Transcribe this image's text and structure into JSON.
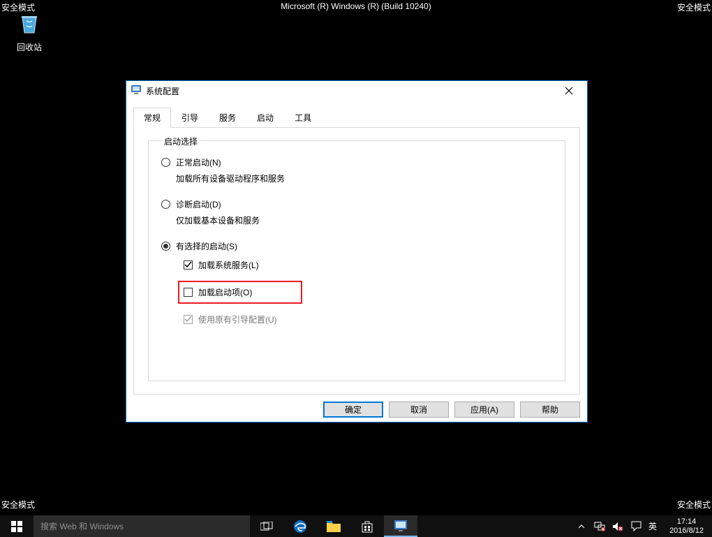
{
  "safe_mode_label": "安全模式",
  "build_info": "Microsoft (R) Windows (R) (Build 10240)",
  "desktop": {
    "recycle_bin": "回收站"
  },
  "dialog": {
    "title": "系统配置",
    "tabs": {
      "general": "常规",
      "boot": "引导",
      "services": "服务",
      "startup": "启动",
      "tools": "工具"
    },
    "fieldset_legend": "启动选择",
    "options": {
      "normal": {
        "label": "正常启动(N)",
        "desc": "加载所有设备驱动程序和服务"
      },
      "diagnostic": {
        "label": "诊断启动(D)",
        "desc": "仅加载基本设备和服务"
      },
      "selective": {
        "label": "有选择的启动(S)",
        "load_services": "加载系统服务(L)",
        "load_startup": "加载启动项(O)",
        "original_boot": "使用原有引导配置(U)"
      }
    },
    "buttons": {
      "ok": "确定",
      "cancel": "取消",
      "apply": "应用(A)",
      "help": "帮助"
    }
  },
  "taskbar": {
    "search_placeholder": "搜索 Web 和 Windows",
    "ime": "英",
    "time": "17:14",
    "date": "2016/8/12"
  }
}
